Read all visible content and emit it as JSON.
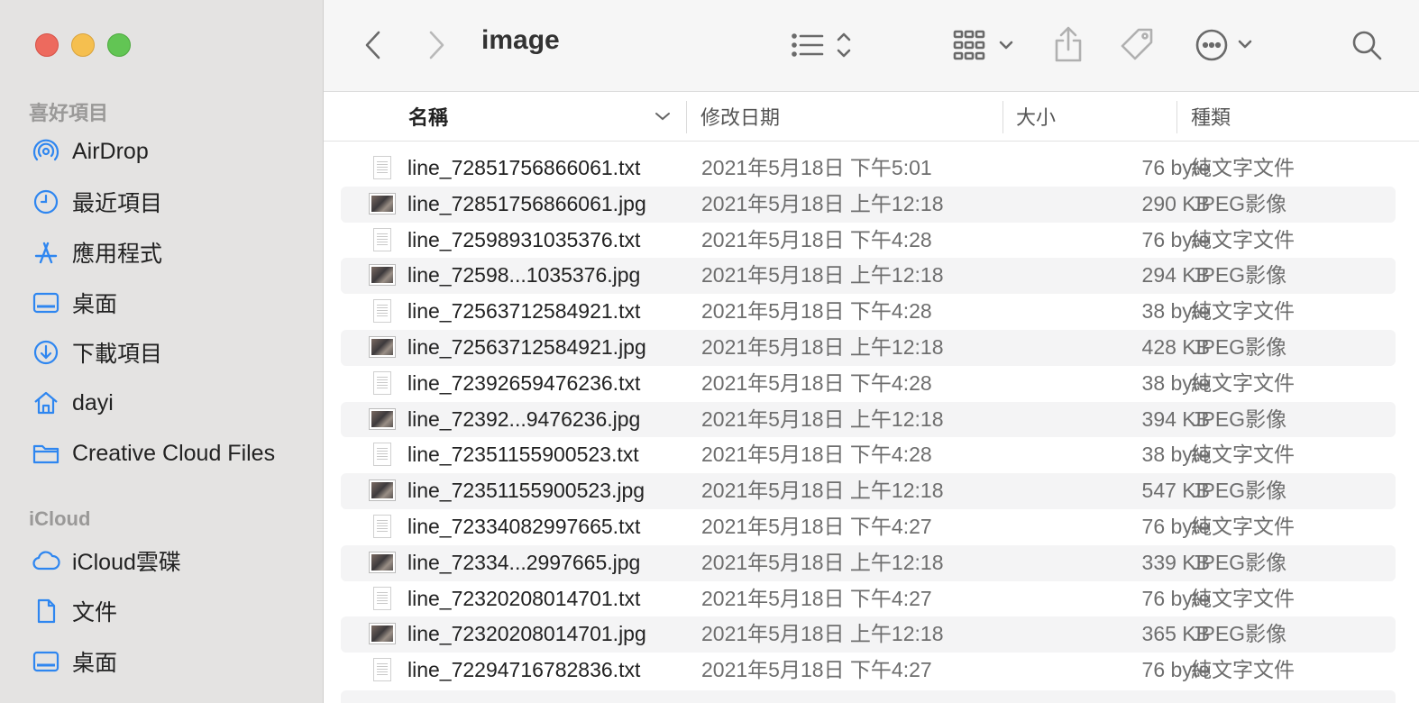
{
  "window": {
    "title": "image"
  },
  "sidebar": {
    "favorites_title": "喜好項目",
    "favorites": [
      {
        "label": "AirDrop",
        "icon": "airdrop-icon"
      },
      {
        "label": "最近項目",
        "icon": "clock-icon"
      },
      {
        "label": "應用程式",
        "icon": "applications-icon"
      },
      {
        "label": "桌面",
        "icon": "desktop-icon"
      },
      {
        "label": "下載項目",
        "icon": "download-icon"
      },
      {
        "label": "dayi",
        "icon": "home-icon"
      },
      {
        "label": "Creative Cloud Files",
        "icon": "folder-icon"
      }
    ],
    "icloud_title": "iCloud",
    "icloud": [
      {
        "label": "iCloud雲碟",
        "icon": "cloud-icon"
      },
      {
        "label": "文件",
        "icon": "document-icon"
      },
      {
        "label": "桌面",
        "icon": "desktop-icon"
      }
    ]
  },
  "columns": {
    "name": "名稱",
    "date": "修改日期",
    "size": "大小",
    "kind": "種類"
  },
  "files": [
    {
      "name": "line_72851756866061.txt",
      "date": "2021年5月18日 下午5:01",
      "size": "76 byte",
      "kind": "純文字文件",
      "type": "txt"
    },
    {
      "name": "line_72851756866061.jpg",
      "date": "2021年5月18日 上午12:18",
      "size": "290 KB",
      "kind": "JPEG影像",
      "type": "jpg"
    },
    {
      "name": "line_72598931035376.txt",
      "date": "2021年5月18日 下午4:28",
      "size": "76 byte",
      "kind": "純文字文件",
      "type": "txt"
    },
    {
      "name": "line_72598...1035376.jpg",
      "date": "2021年5月18日 上午12:18",
      "size": "294 KB",
      "kind": "JPEG影像",
      "type": "jpg"
    },
    {
      "name": "line_72563712584921.txt",
      "date": "2021年5月18日 下午4:28",
      "size": "38 byte",
      "kind": "純文字文件",
      "type": "txt"
    },
    {
      "name": "line_72563712584921.jpg",
      "date": "2021年5月18日 上午12:18",
      "size": "428 KB",
      "kind": "JPEG影像",
      "type": "jpg"
    },
    {
      "name": "line_72392659476236.txt",
      "date": "2021年5月18日 下午4:28",
      "size": "38 byte",
      "kind": "純文字文件",
      "type": "txt"
    },
    {
      "name": "line_72392...9476236.jpg",
      "date": "2021年5月18日 上午12:18",
      "size": "394 KB",
      "kind": "JPEG影像",
      "type": "jpg"
    },
    {
      "name": "line_72351155900523.txt",
      "date": "2021年5月18日 下午4:28",
      "size": "38 byte",
      "kind": "純文字文件",
      "type": "txt"
    },
    {
      "name": "line_72351155900523.jpg",
      "date": "2021年5月18日 上午12:18",
      "size": "547 KB",
      "kind": "JPEG影像",
      "type": "jpg"
    },
    {
      "name": "line_72334082997665.txt",
      "date": "2021年5月18日 下午4:27",
      "size": "76 byte",
      "kind": "純文字文件",
      "type": "txt"
    },
    {
      "name": "line_72334...2997665.jpg",
      "date": "2021年5月18日 上午12:18",
      "size": "339 KB",
      "kind": "JPEG影像",
      "type": "jpg"
    },
    {
      "name": "line_72320208014701.txt",
      "date": "2021年5月18日 下午4:27",
      "size": "76 byte",
      "kind": "純文字文件",
      "type": "txt"
    },
    {
      "name": "line_72320208014701.jpg",
      "date": "2021年5月18日 上午12:18",
      "size": "365 KB",
      "kind": "JPEG影像",
      "type": "jpg"
    },
    {
      "name": "line_72294716782836.txt",
      "date": "2021年5月18日 下午4:27",
      "size": "76 byte",
      "kind": "純文字文件",
      "type": "txt"
    }
  ]
}
